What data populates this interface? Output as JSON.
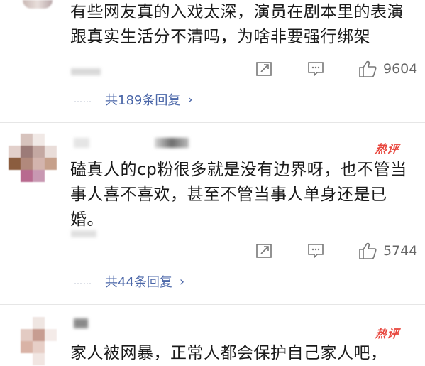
{
  "comments": [
    {
      "text": "有些网友真的入戏太深，演员在剧本里的表演跟真实生活分不清吗，为啥非要强行绑架",
      "actions": {
        "share_icon": "share-icon",
        "comment_icon": "comment-icon",
        "like_icon": "thumbs-up-icon",
        "like_count": "9604"
      },
      "reply": {
        "dots": "……",
        "label": "共189条回复",
        "chevron": "›"
      }
    },
    {
      "hot_badge": "热评",
      "text": "磕真人的cp粉很多就是没有边界呀，也不管当事人喜不喜欢，甚至不管当事人单身还是已婚。",
      "actions": {
        "share_icon": "share-icon",
        "comment_icon": "comment-icon",
        "like_icon": "thumbs-up-icon",
        "like_count": "5744"
      },
      "reply": {
        "dots": "……",
        "label": "共44条回复",
        "chevron": "›"
      }
    },
    {
      "hot_badge": "热评",
      "text": "家人被网暴，正常人都会保护自己家人吧，"
    }
  ],
  "colors": {
    "link": "#4a66a8",
    "hot": "#e8453c",
    "icon": "#777777",
    "text": "#1a1a1a"
  }
}
